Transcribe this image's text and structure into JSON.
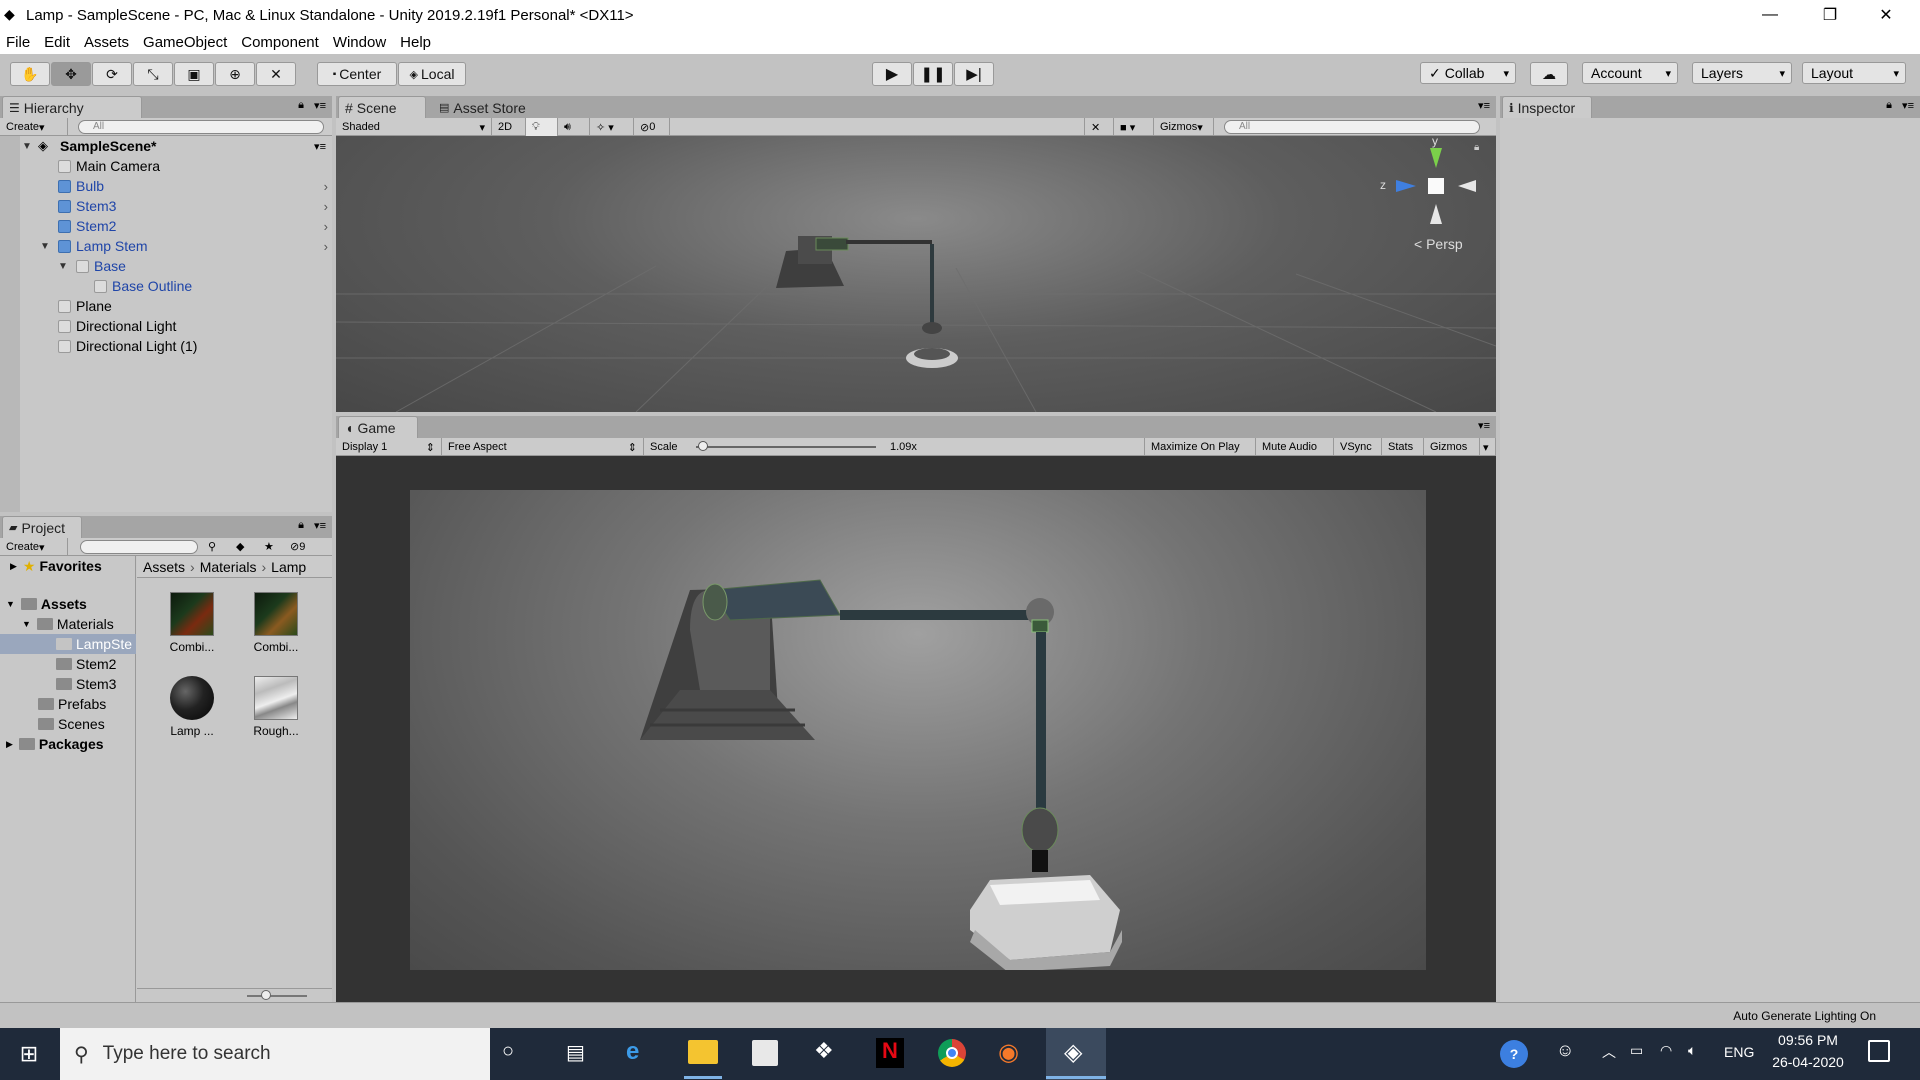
{
  "window": {
    "title": "Lamp - SampleScene - PC, Mac & Linux Standalone - Unity 2019.2.19f1 Personal* <DX11>"
  },
  "menu": [
    "File",
    "Edit",
    "Assets",
    "GameObject",
    "Component",
    "Window",
    "Help"
  ],
  "toolbar": {
    "center": "Center",
    "local": "Local",
    "collab": "Collab",
    "account": "Account",
    "layers": "Layers",
    "layout": "Layout"
  },
  "hierarchy": {
    "tab": "Hierarchy",
    "create": "Create",
    "search_placeholder": "All",
    "scene": "SampleScene*",
    "items": [
      {
        "label": "Main Camera",
        "blue": false,
        "indent": 0
      },
      {
        "label": "Bulb",
        "blue": true,
        "indent": 0
      },
      {
        "label": "Stem3",
        "blue": true,
        "indent": 0
      },
      {
        "label": "Stem2",
        "blue": true,
        "indent": 0
      },
      {
        "label": "Lamp Stem",
        "blue": true,
        "indent": 0
      },
      {
        "label": "Base",
        "blue": true,
        "indent": 1
      },
      {
        "label": "Base Outline",
        "blue": true,
        "indent": 2
      },
      {
        "label": "Plane",
        "blue": false,
        "indent": 0
      },
      {
        "label": "Directional Light",
        "blue": false,
        "indent": 0
      },
      {
        "label": "Directional Light (1)",
        "blue": false,
        "indent": 0
      }
    ]
  },
  "project": {
    "tab": "Project",
    "create": "Create",
    "badge": "9",
    "favorites": "Favorites",
    "assets": "Assets",
    "tree": [
      "Materials",
      "LampSte",
      "Stem2",
      "Stem3",
      "Prefabs",
      "Scenes"
    ],
    "packages": "Packages",
    "breadcrumb": [
      "Assets",
      "Materials",
      "Lamp"
    ],
    "files": [
      "Combi...",
      "Combi...",
      "Lamp ...",
      "Rough..."
    ]
  },
  "scene": {
    "tab": "Scene",
    "tab2": "Asset Store",
    "shading": "Shaded",
    "mode2d": "2D",
    "hidden_count": "0",
    "gizmos": "Gizmos",
    "search_placeholder": "All",
    "persp": "Persp",
    "axis_y": "y",
    "axis_z": "z"
  },
  "game": {
    "tab": "Game",
    "display": "Display 1",
    "aspect": "Free Aspect",
    "scale_label": "Scale",
    "scale_value": "1.09x",
    "maximize": "Maximize On Play",
    "mute": "Mute Audio",
    "vsync": "VSync",
    "stats": "Stats",
    "gizmos": "Gizmos"
  },
  "inspector": {
    "tab": "Inspector"
  },
  "status": {
    "text": "Auto Generate Lighting On"
  },
  "taskbar": {
    "search_placeholder": "Type here to search",
    "lang": "ENG",
    "time": "09:56 PM",
    "date": "26-04-2020"
  }
}
